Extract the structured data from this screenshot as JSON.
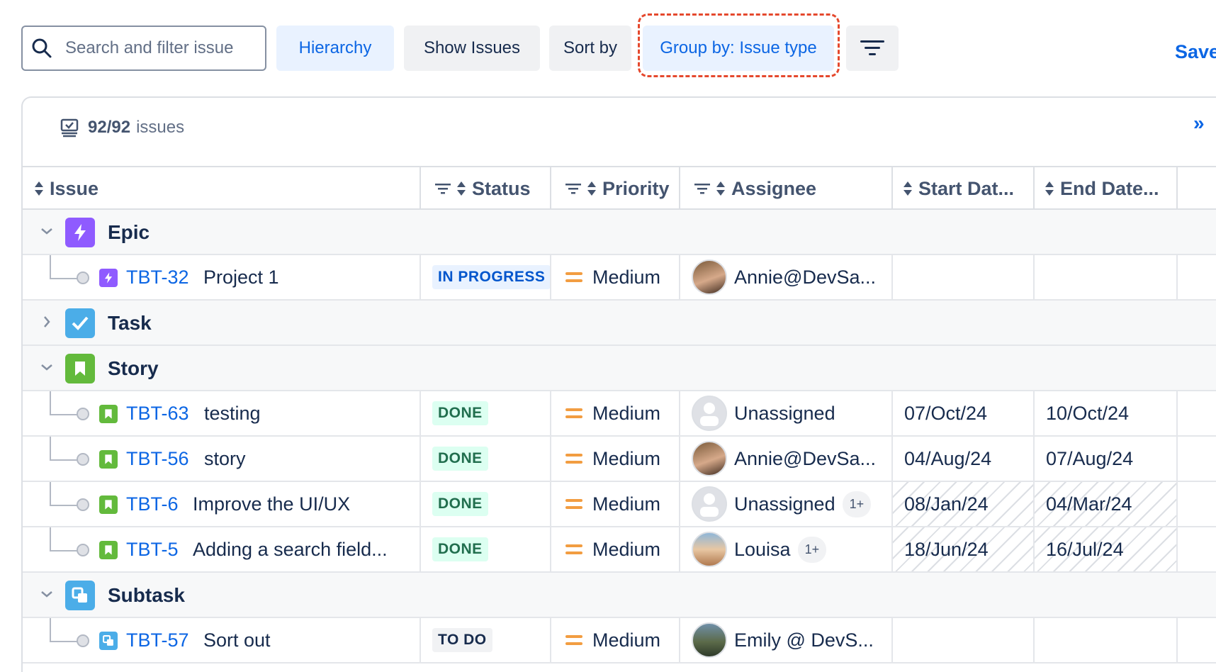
{
  "toolbar": {
    "search_placeholder": "Search and filter issue",
    "hierarchy_label": "Hierarchy",
    "show_issues_label": "Show Issues",
    "sort_by_label": "Sort by",
    "group_by_label": "Group by: Issue type",
    "save_label": "Save"
  },
  "summary": {
    "count": "92/92",
    "label": "issues"
  },
  "columns": {
    "issue": "Issue",
    "status": "Status",
    "priority": "Priority",
    "assignee": "Assignee",
    "start": "Start Dat...",
    "end": "End Date..."
  },
  "groups": {
    "epic": "Epic",
    "task": "Task",
    "story": "Story",
    "subtask": "Subtask"
  },
  "rows": [
    {
      "key": "TBT-32",
      "summary": "Project 1",
      "status": "IN PROGRESS",
      "priority": "Medium",
      "assignee": "Annie@DevSa...",
      "more": "",
      "start": "",
      "end": ""
    },
    {
      "key": "TBT-63",
      "summary": "testing",
      "status": "DONE",
      "priority": "Medium",
      "assignee": "Unassigned",
      "more": "",
      "start": "07/Oct/24",
      "end": "10/Oct/24"
    },
    {
      "key": "TBT-56",
      "summary": "story",
      "status": "DONE",
      "priority": "Medium",
      "assignee": "Annie@DevSa...",
      "more": "",
      "start": "04/Aug/24",
      "end": "07/Aug/24"
    },
    {
      "key": "TBT-6",
      "summary": "Improve the UI/UX",
      "status": "DONE",
      "priority": "Medium",
      "assignee": "Unassigned",
      "more": "1+",
      "start": "08/Jan/24",
      "end": "04/Mar/24"
    },
    {
      "key": "TBT-5",
      "summary": "Adding a search field...",
      "status": "DONE",
      "priority": "Medium",
      "assignee": "Louisa",
      "more": "1+",
      "start": "18/Jun/24",
      "end": "16/Jul/24"
    },
    {
      "key": "TBT-57",
      "summary": "Sort out",
      "status": "TO DO",
      "priority": "Medium",
      "assignee": "Emily @ DevS...",
      "more": "",
      "start": "",
      "end": ""
    }
  ],
  "colors": {
    "link": "#0c66e4",
    "epic": "#8f5bff",
    "task": "#4bade8",
    "story": "#63ba3c",
    "subtask": "#4bade8",
    "highlight": "#e5482d"
  }
}
